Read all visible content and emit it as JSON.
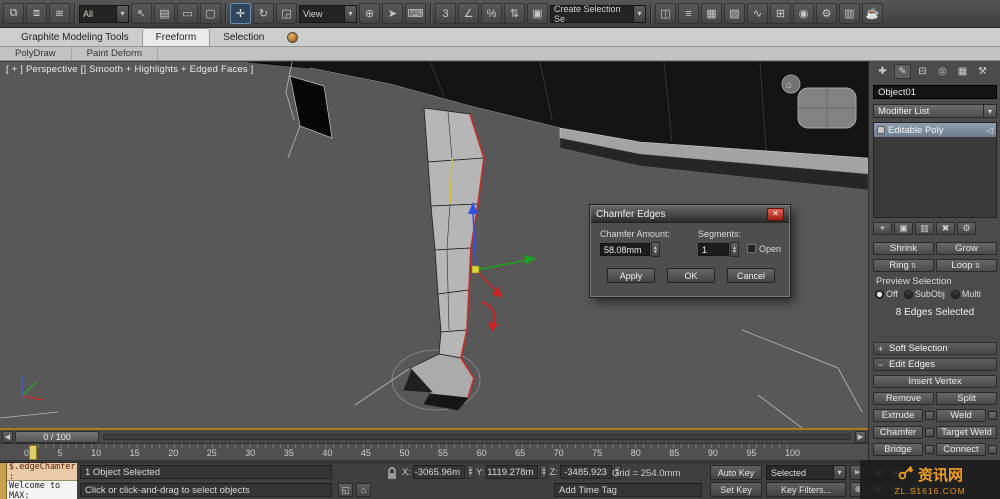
{
  "toolbar": {
    "selection_filter_value": "All",
    "reference_coordinate_value": "View",
    "named_selection_value": "Create Selection Se",
    "icons_left": [
      {
        "name": "select-and-link-icon",
        "glyph": "⧉"
      },
      {
        "name": "unlink-selection-icon",
        "glyph": "⧈"
      },
      {
        "name": "bind-to-spacewarp-icon",
        "glyph": "≋"
      }
    ],
    "icons_select": [
      {
        "name": "select-object-icon",
        "glyph": "↖"
      },
      {
        "name": "select-by-name-icon",
        "glyph": "▤"
      },
      {
        "name": "rectangular-selection-region-icon",
        "glyph": "▭"
      },
      {
        "name": "window-crossing-icon",
        "glyph": "▢"
      }
    ],
    "icons_transform": [
      {
        "name": "select-and-move-icon",
        "glyph": "✛",
        "active": true
      },
      {
        "name": "select-and-rotate-icon",
        "glyph": "↻"
      },
      {
        "name": "select-and-scale-icon",
        "glyph": "◲"
      }
    ],
    "icons_mid": [
      {
        "name": "use-pivot-center-icon",
        "glyph": "⊕"
      },
      {
        "name": "select-and-manipulate-icon",
        "glyph": "➤"
      },
      {
        "name": "keyboard-override-icon",
        "glyph": "⌨"
      }
    ],
    "icons_snap": [
      {
        "name": "snaps-toggle-icon",
        "glyph": "3"
      },
      {
        "name": "angle-snap-icon",
        "glyph": "∠"
      },
      {
        "name": "percent-snap-icon",
        "glyph": "%"
      },
      {
        "name": "spinner-snap-icon",
        "glyph": "⇅"
      },
      {
        "name": "named-selection-sets-icon",
        "glyph": "▣"
      }
    ],
    "icons_right": [
      {
        "name": "mirror-icon",
        "glyph": "◫"
      },
      {
        "name": "align-icon",
        "glyph": "≡"
      },
      {
        "name": "layer-manager-icon",
        "glyph": "▦"
      },
      {
        "name": "graphite-ribbon-toggle-icon",
        "glyph": "▧"
      },
      {
        "name": "curve-editor-icon",
        "glyph": "∿"
      },
      {
        "name": "schematic-view-icon",
        "glyph": "⊞"
      },
      {
        "name": "material-editor-icon",
        "glyph": "◉"
      },
      {
        "name": "render-setup-icon",
        "glyph": "⚙"
      },
      {
        "name": "rendered-frame-icon",
        "glyph": "▥"
      },
      {
        "name": "render-production-icon",
        "glyph": "☕"
      }
    ]
  },
  "ribbon": {
    "tabs": [
      {
        "label": "Graphite Modeling Tools",
        "active": false
      },
      {
        "label": "Freeform",
        "active": true
      },
      {
        "label": "Selection",
        "active": false
      }
    ],
    "panels": [
      {
        "label": "PolyDraw"
      },
      {
        "label": "Paint Deform"
      }
    ]
  },
  "viewport": {
    "label": "[ + ] Perspective [] Smooth + Highlights + Edged Faces ]"
  },
  "dialog": {
    "title": "Chamfer Edges",
    "close_glyph": "✕",
    "chamfer_amount_label": "Chamfer Amount:",
    "chamfer_amount_value": "58.08mm",
    "segments_label": "Segments:",
    "segments_value": "1",
    "open_label": "Open",
    "apply_label": "Apply",
    "ok_label": "OK",
    "cancel_label": "Cancel"
  },
  "command_panel": {
    "tab_icons": [
      {
        "name": "create-tab-icon",
        "glyph": "✚"
      },
      {
        "name": "modify-tab-icon",
        "glyph": "✎",
        "active": true
      },
      {
        "name": "hierarchy-tab-icon",
        "glyph": "⊟"
      },
      {
        "name": "motion-tab-icon",
        "glyph": "◎"
      },
      {
        "name": "display-tab-icon",
        "glyph": "▦"
      },
      {
        "name": "utilities-tab-icon",
        "glyph": "⚒"
      }
    ],
    "object_name": "Object01",
    "modifier_list_label": "Modifier List",
    "stack_items": [
      {
        "label": "Editable Poly",
        "selected": true
      }
    ],
    "stack_tool_icons": [
      {
        "name": "pin-stack-icon",
        "glyph": "⌖"
      },
      {
        "name": "show-end-result-icon",
        "glyph": "▣"
      },
      {
        "name": "make-unique-icon",
        "glyph": "▥"
      },
      {
        "name": "remove-modifier-icon",
        "glyph": "✖"
      },
      {
        "name": "configure-modifier-sets-icon",
        "glyph": "⚙"
      }
    ],
    "selection_tools": {
      "shrink": "Shrink",
      "grow": "Grow",
      "ring": "Ring",
      "loop": "Loop"
    },
    "preview_selection_label": "Preview Selection",
    "preview_options": [
      {
        "label": "Off",
        "selected": true
      },
      {
        "label": "SubObj",
        "selected": false
      },
      {
        "label": "Multi",
        "selected": false
      }
    ],
    "selection_status": "8 Edges Selected",
    "rollout_soft_selection": {
      "marker": "+",
      "label": "Soft Selection"
    },
    "rollout_edit_edges": {
      "marker": "−",
      "label": "Edit Edges"
    },
    "edit_edges": {
      "insert_vertex": "Insert Vertex",
      "remove": "Remove",
      "split": "Split",
      "extrude": "Extrude",
      "weld": "Weld",
      "chamfer": "Chamfer",
      "target_weld": "Target Weld",
      "bridge": "Bridge",
      "connect": "Connect"
    }
  },
  "timeline": {
    "slider_value": "0 / 100",
    "ticks": [
      "0",
      "5",
      "10",
      "15",
      "20",
      "25",
      "30",
      "35",
      "40",
      "45",
      "50",
      "55",
      "60",
      "65",
      "70",
      "75",
      "80",
      "85",
      "90",
      "95",
      "100"
    ]
  },
  "status": {
    "listener_line1": "$.edgeChamfer :",
    "listener_line2": "Welcome to MAX:",
    "selection_info": "1 Object Selected",
    "prompt": "Click or click-and-drag to select objects",
    "x_label": "X:",
    "x_value": "-3065.96m",
    "y_label": "Y:",
    "y_value": "1119.278m",
    "z_label": "Z:",
    "z_value": "-3485.923",
    "grid_info": "Grid = 254.0mm",
    "add_time_tag": "Add Time Tag",
    "auto_key": "Auto Key",
    "set_key": "Set Key",
    "track_set_value": "Selected",
    "key_filters": "Key Filters...",
    "mini_icons": [
      {
        "name": "isolate-selection-icon",
        "glyph": "◱"
      },
      {
        "name": "offset-mode-icon",
        "glyph": "⌂"
      }
    ],
    "playback_icons": [
      {
        "name": "go-to-start-icon",
        "glyph": "⇤"
      },
      {
        "name": "previous-frame-icon",
        "glyph": "◂"
      },
      {
        "name": "play-animation-icon",
        "glyph": "▸"
      }
    ],
    "nav_icons": [
      {
        "name": "zoom-icon",
        "glyph": "⊕"
      },
      {
        "name": "pan-icon",
        "glyph": "✥"
      },
      {
        "name": "orbit-icon",
        "glyph": "⟳"
      },
      {
        "name": "maximize-viewport-toggle-icon",
        "glyph": "▣"
      }
    ]
  },
  "watermark": {
    "line1": "资讯网",
    "line2": "ZL.S1616.COM"
  }
}
